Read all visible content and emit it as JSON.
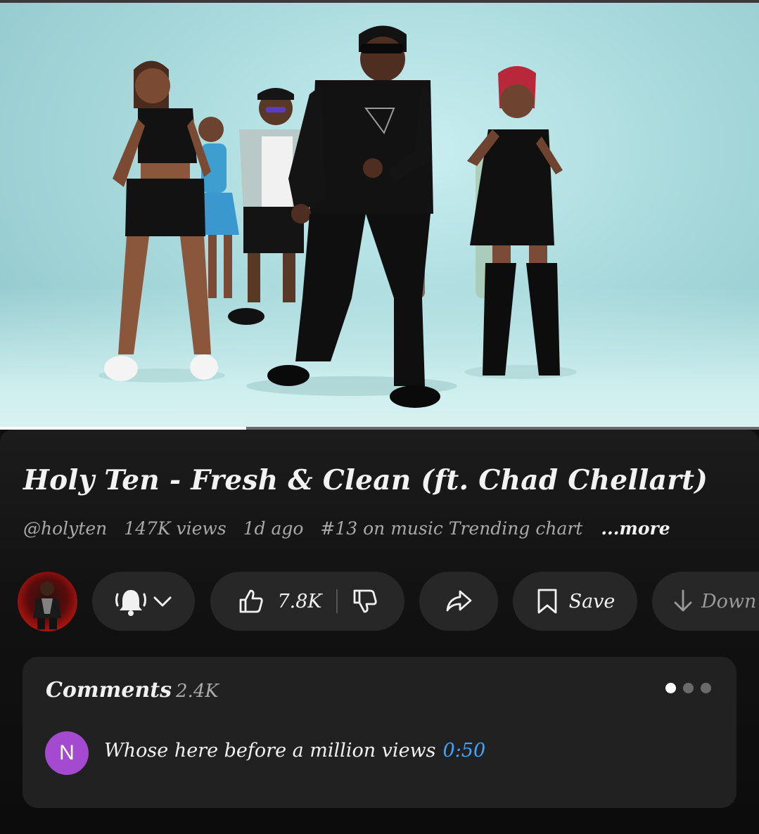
{
  "video": {
    "progress_fraction": 0.324
  },
  "info": {
    "title": "Holy Ten - Fresh & Clean (ft. Chad Chellart)",
    "channel_handle": "@holyten",
    "views": "147K views",
    "age": "1d ago",
    "trending": "#13 on music Trending chart",
    "more": "...more"
  },
  "actions": {
    "like_count": "7.8K",
    "save_label": "Save",
    "download_label": "Down"
  },
  "comments": {
    "title": "Comments",
    "count": "2.4K",
    "pager_dots": 3,
    "active_dot": 0,
    "top_comment": {
      "avatar_letter": "N",
      "text": "Whose here before a million views",
      "timestamp": "0:50"
    }
  },
  "colors": {
    "background": "#0f0f0f",
    "pill": "#272727",
    "card": "#212121",
    "link_blue": "#3ea6ff",
    "avatar_purple": "#a44ad1"
  }
}
